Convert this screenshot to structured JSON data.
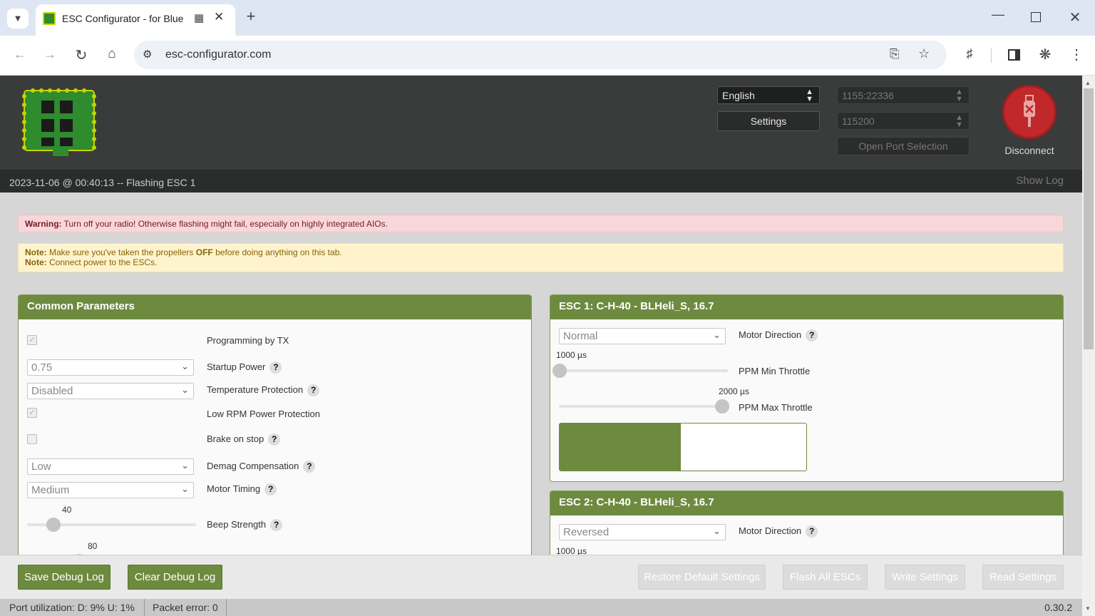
{
  "browser": {
    "tab_title": "ESC Configurator - for Blue",
    "url": "esc-configurator.com",
    "new_tab": "+",
    "close_tab": "✕"
  },
  "header": {
    "language": "English",
    "settings_label": "Settings",
    "port": "1155:22336",
    "baud": "115200",
    "open_port_label": "Open Port Selection",
    "disconnect_label": "Disconnect"
  },
  "log": {
    "last_line": "2023-11-06 @ 00:40:13 -- Flashing ESC 1",
    "show_log_label": "Show Log"
  },
  "alerts": {
    "warning_label": "Warning:",
    "warning_text": "Turn off your radio! Otherwise flashing might fail, especially on highly integrated AIOs.",
    "note_label": "Note:",
    "note1_pre": "Make sure you've taken the propellers",
    "note1_bold": "OFF",
    "note1_post": "before doing anything on this tab.",
    "note2": "Connect power to the ESCs."
  },
  "common": {
    "title": "Common Parameters",
    "programming_by_tx": "Programming by TX",
    "startup_power_value": "0.75",
    "startup_power": "Startup Power",
    "temp_protection_value": "Disabled",
    "temp_protection": "Temperature Protection",
    "low_rpm": "Low RPM Power Protection",
    "brake_on_stop": "Brake on stop",
    "demag_value": "Low",
    "demag": "Demag Compensation",
    "motor_timing_value": "Medium",
    "motor_timing": "Motor Timing",
    "beep_value": "40",
    "beep_value_fraction": 0.16,
    "beep": "Beep Strength",
    "beacon_value": "80",
    "help": "?"
  },
  "esc1": {
    "title": "ESC 1: C-H-40 - BLHeli_S, 16.7",
    "direction_value": "Normal",
    "direction": "Motor Direction",
    "min_value": "1000 µs",
    "min_label": "PPM Min Throttle",
    "max_value": "2000 µs",
    "max_label": "PPM Max Throttle",
    "progress_fraction": 0.49
  },
  "esc2": {
    "title": "ESC 2: C-H-40 - BLHeli_S, 16.7",
    "direction_value": "Reversed",
    "direction": "Motor Direction",
    "min_value": "1000 µs"
  },
  "footer": {
    "save_debug": "Save Debug Log",
    "clear_debug": "Clear Debug Log",
    "restore": "Restore Default Settings",
    "flash_all": "Flash All ESCs",
    "write": "Write Settings",
    "read": "Read Settings"
  },
  "statusbar": {
    "port_util": "Port utilization: D: 9% U: 1%",
    "packet_error": "Packet error: 0",
    "version": "0.30.2"
  },
  "colors": {
    "accent": "#6d8a3f",
    "disconnect": "#c0282a",
    "warning_bg": "#f8d7da",
    "note_bg": "#fff3cd"
  }
}
